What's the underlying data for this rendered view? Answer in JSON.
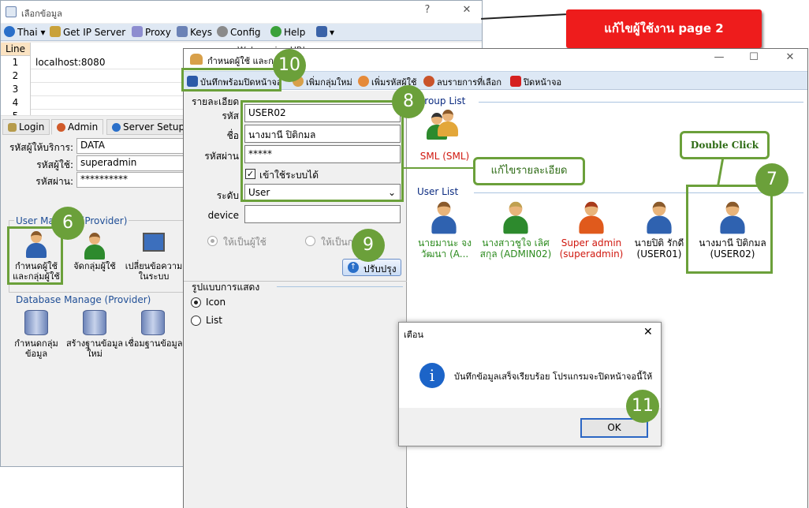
{
  "back": {
    "title": "เลือกข้อมูล",
    "help_glyph": "?",
    "close_glyph": "✕",
    "menu": [
      {
        "label": "Thai"
      },
      {
        "label": "Get IP Server"
      },
      {
        "label": "Proxy"
      },
      {
        "label": "Keys"
      },
      {
        "label": "Config"
      },
      {
        "label": "Help"
      }
    ],
    "lines_header": "Line",
    "lines": [
      {
        "num": "1",
        "value": "localhost:8080"
      },
      {
        "num": "2",
        "value": ""
      },
      {
        "num": "3",
        "value": ""
      },
      {
        "num": "4",
        "value": ""
      },
      {
        "num": "5",
        "value": ""
      }
    ],
    "tabs": [
      "Login",
      "Admin",
      "Server Setup"
    ],
    "webservice_url": "Webservice URL",
    "fields": [
      {
        "label": "รหัสผู้ให้บริการ:",
        "value": "DATA"
      },
      {
        "label": "รหัสผู้ใช้:",
        "value": "superadmin"
      },
      {
        "label": "รหัสผ่าน:",
        "value": "**********"
      }
    ],
    "user_manage_title": "User Manage (Provider)",
    "user_manage_items": [
      "กำหนดผู้ใช้และกลุ่มผู้ใช้",
      "จัดกลุ่มผู้ใช้",
      "เปลี่ยนข้อความในระบบ"
    ],
    "db_manage_title": "Database Manage (Provider)",
    "db_manage_items": [
      "กำหนดกลุ่มข้อมูล",
      "สร้างฐานข้อมูลใหม่",
      "เชื่อมฐานข้อมูล"
    ]
  },
  "banner": "แก้ไขผู้ใช้งาน  page 2",
  "main": {
    "title": "กำหนดผู้ใช้ และกลุ่มผู้ใช้",
    "minimize_glyph": "—",
    "maximize_glyph": "☐",
    "close_glyph": "✕",
    "toolbar": [
      "บันทึกพร้อมปิดหน้าจอ",
      "เพิ่มกลุ่มใหม่",
      "เพิ่มรหัสผู้ใช้",
      "ลบรายการที่เลือก",
      "ปิดหน้าจอ"
    ],
    "details_title": "รายละเอียด",
    "form": {
      "code_label": "รหัส",
      "code_value": "USER02",
      "name_label": "ชื่อ",
      "name_value": "นางมานี ปิติกมล",
      "password_label": "รหัสผ่าน",
      "password_value": "*****",
      "login_allowed_label": "เข้าใช้ระบบได้",
      "level_label": "ระดับ",
      "level_value": "User",
      "device_label": "device",
      "device_value": ""
    },
    "radio_user": "ให้เป็นผู้ใช้",
    "radio_group": "ให้เป็นกลุ่ม",
    "update_button": "ปรับปรุง",
    "display_title": "รูปแบบการแสดง",
    "display_icon": "Icon",
    "display_list": "List",
    "group_list_title": "Group List",
    "groups": [
      {
        "label": "SML (SML)"
      }
    ],
    "user_list_title": "User List",
    "users": [
      {
        "line1": "นายมานะ จง",
        "line2": "วัฒนา (A..."
      },
      {
        "line1": "นางสาวชูใจ เลิศ",
        "line2": "สกุล (ADMIN02)"
      },
      {
        "line1": "Super admin",
        "line2": "(superadmin)"
      },
      {
        "line1": "นายปิติ รักดี",
        "line2": "(USER01)"
      },
      {
        "line1": "นางมานี ปิติกมล",
        "line2": "(USER02)"
      }
    ]
  },
  "dialog": {
    "title": "เตือน",
    "close_glyph": "✕",
    "message": "บันทึกข้อมูลเสร็จเรียบร้อย โปรแกรมจะปิดหน้าจอนี้ให้",
    "ok": "OK"
  },
  "callouts": {
    "n6": "6",
    "n7": "7",
    "n8": "8",
    "n9": "9",
    "n10": "10",
    "n11": "11",
    "edit_details": "แก้ไขรายละเอียด",
    "double_click": "Double Click"
  }
}
